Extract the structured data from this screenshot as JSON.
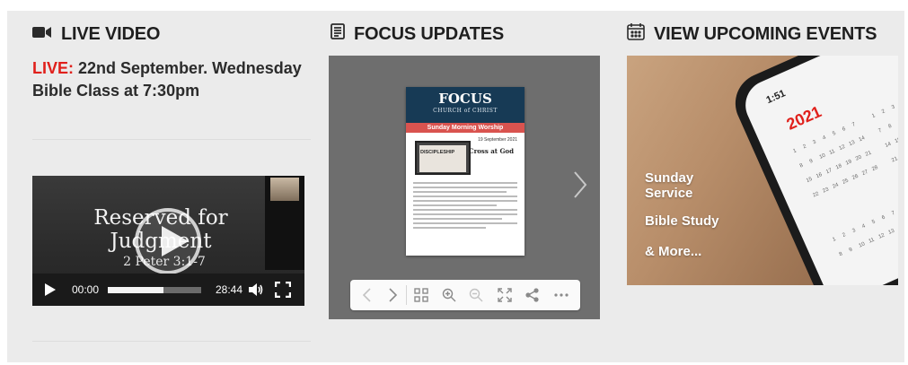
{
  "live": {
    "title": "LIVE VIDEO",
    "live_label": "LIVE:",
    "message": "22nd September. Wednesday Bible Class at 7:30pm"
  },
  "video": {
    "title": "Reserved for Judgment",
    "reference": "2 Peter 3:1-7",
    "current_time": "00:00",
    "duration": "28:44",
    "progress_fraction": 0.6
  },
  "focus": {
    "title": "FOCUS UPDATES",
    "page": {
      "brand": "FOCUS",
      "org": "CHURCH of CHRIST",
      "band": "Sunday Morning Worship",
      "date": "19 September 2021",
      "heading": "Cross at God",
      "screen_word": "DISCIPLESHIP"
    }
  },
  "events": {
    "title": "VIEW UPCOMING EVENTS",
    "items": [
      "Sunday Service",
      "Bible Study",
      "& More..."
    ],
    "phone": {
      "time": "1:51",
      "year": "2021"
    }
  },
  "colors": {
    "accent_red": "#e0201b",
    "panel_bg": "#ebebeb",
    "focus_header": "#173a55"
  }
}
